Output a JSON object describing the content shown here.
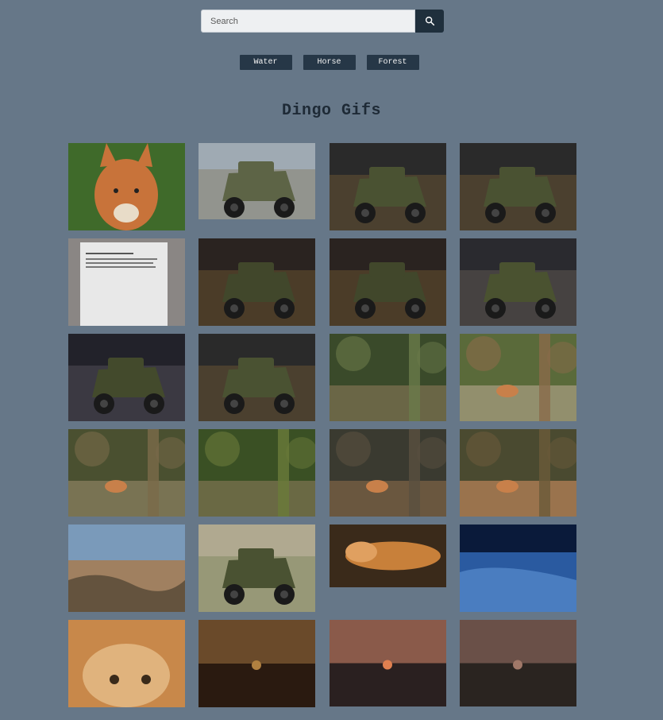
{
  "search": {
    "placeholder": "Search",
    "value": "",
    "button_icon": "search-icon"
  },
  "tags": [
    {
      "label": "Water"
    },
    {
      "label": "Horse"
    },
    {
      "label": "Forest"
    }
  ],
  "page_title": "Dingo Gifs",
  "gallery": [
    {
      "subject": "dingo-portrait",
      "palette": [
        "#3f6a2a",
        "#c8733a",
        "#7a9a45"
      ]
    },
    {
      "subject": "armored-car-outdoor",
      "palette": [
        "#9eaab3",
        "#5d6446",
        "#7a6e4a"
      ]
    },
    {
      "subject": "armored-car-museum-front",
      "palette": [
        "#2a2a2a",
        "#4a5232",
        "#8a6a3a"
      ]
    },
    {
      "subject": "armored-car-museum-front",
      "palette": [
        "#2a2a2a",
        "#4a5232",
        "#8a6a3a"
      ]
    },
    {
      "subject": "museum-placard",
      "palette": [
        "#8a8684",
        "#e8e8e8",
        "#6a6664"
      ]
    },
    {
      "subject": "armored-car-museum-rear",
      "palette": [
        "#2a2420",
        "#41472b",
        "#8a6a3a"
      ]
    },
    {
      "subject": "armored-car-museum-rear",
      "palette": [
        "#2a2420",
        "#41472b",
        "#8a6a3a"
      ]
    },
    {
      "subject": "armored-car-museum-rear-plate",
      "palette": [
        "#2a2a30",
        "#4a5230",
        "#7b7060"
      ]
    },
    {
      "subject": "armored-car-museum-rear-plate",
      "palette": [
        "#22222a",
        "#434a2c",
        "#6a6470"
      ]
    },
    {
      "subject": "armored-car-museum-side",
      "palette": [
        "#2a2a2a",
        "#4a5232",
        "#8a6a3a"
      ]
    },
    {
      "subject": "forest-tree",
      "palette": [
        "#3a4a2a",
        "#6a7a4a",
        "#8a7a5a"
      ]
    },
    {
      "subject": "forest-dingo-rabbit",
      "palette": [
        "#5a6a3a",
        "#8a6a4a",
        "#b8a890"
      ]
    },
    {
      "subject": "forest-dingo",
      "palette": [
        "#4a5030",
        "#7a6a4a",
        "#9a8a6a"
      ]
    },
    {
      "subject": "forest-undergrowth",
      "palette": [
        "#3a5024",
        "#6a7a3a",
        "#8a7a5a"
      ]
    },
    {
      "subject": "enclosure-dingo",
      "palette": [
        "#3a3a30",
        "#5a5040",
        "#8a6a4a"
      ]
    },
    {
      "subject": "dingo-in-leaves",
      "palette": [
        "#4a4a30",
        "#6a5a3a",
        "#d09060"
      ]
    },
    {
      "subject": "rocky-beach",
      "palette": [
        "#7a9aba",
        "#a08060",
        "#4a4030"
      ]
    },
    {
      "subject": "armored-car-grass",
      "palette": [
        "#b0a890",
        "#4a5232",
        "#6a7a4a"
      ]
    },
    {
      "subject": "sleeping-dingo",
      "palette": [
        "#3a2a1a",
        "#c8803a",
        "#e0a060"
      ]
    },
    {
      "subject": "night-shore",
      "palette": [
        "#0a1a3a",
        "#2a5aa0",
        "#6aa0e0"
      ]
    },
    {
      "subject": "wildlife-magazine-dingo",
      "palette": [
        "#c8884a",
        "#f0d0a0",
        "#3a2a1a"
      ]
    },
    {
      "subject": "dingo-sunset-forest",
      "palette": [
        "#2a1a10",
        "#6a4a2a",
        "#b08040"
      ]
    },
    {
      "subject": "sunset-horizon",
      "palette": [
        "#2a2020",
        "#8a5a4a",
        "#e08050"
      ]
    },
    {
      "subject": "dusk-landscape",
      "palette": [
        "#2a2420",
        "#6a5048",
        "#a07868"
      ]
    }
  ]
}
